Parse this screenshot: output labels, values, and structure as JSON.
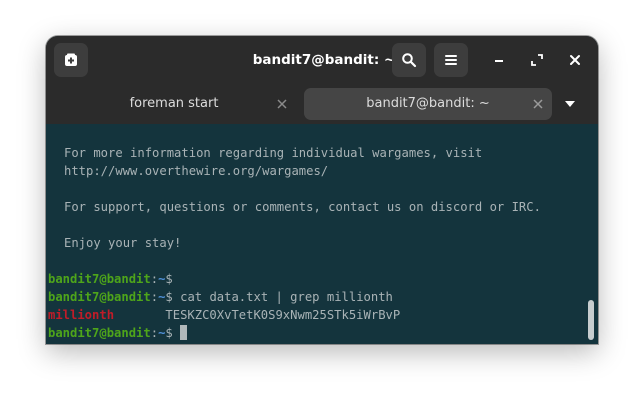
{
  "window": {
    "title": "bandit7@bandit: ~",
    "icons": [
      "new-tab-icon",
      "search-icon",
      "hamburger-menu-icon",
      "minimize-icon",
      "maximize-icon",
      "close-icon"
    ]
  },
  "tabs": [
    {
      "label": "foreman start",
      "active": false
    },
    {
      "label": "bandit7@bandit: ~",
      "active": true
    }
  ],
  "terminal": {
    "motd": [
      "For more information regarding individual wargames, visit",
      "http://www.overthewire.org/wargames/",
      "For support, questions or comments, contact us on discord or IRC.",
      "Enjoy your stay!"
    ],
    "prompt": {
      "user": "bandit7@bandit",
      "separator": ":",
      "path": "~",
      "symbol": "$"
    },
    "command": " cat data.txt | grep millionth",
    "output_match": "millionth",
    "output_rest": "       TESKZC0XvTetK0S9xNwm25STk5iWrBvP"
  },
  "colors": {
    "background": "#14343d",
    "titlebar": "#2b2b2b",
    "prompt_user": "#4ea51a",
    "prompt_path": "#4f8fd6",
    "grep_match": "#c01c28"
  }
}
